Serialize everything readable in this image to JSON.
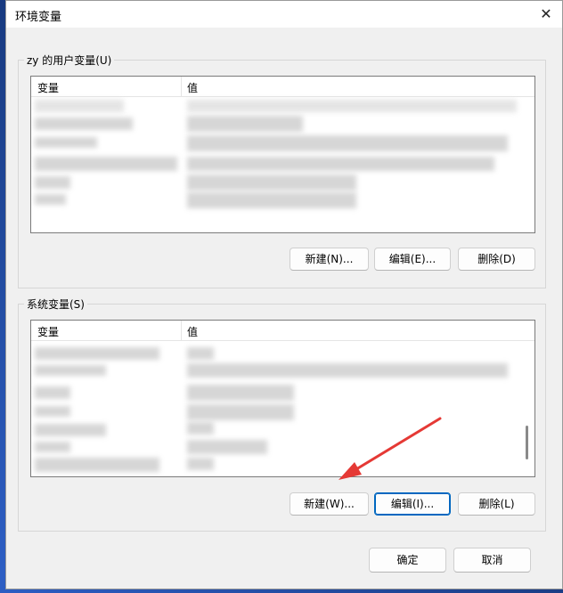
{
  "window": {
    "title": "环境变量",
    "close_glyph": "✕"
  },
  "user_group": {
    "label": "zy 的用户变量(U)",
    "columns": {
      "variable": "变量",
      "value": "值"
    },
    "buttons": {
      "new": "新建(N)...",
      "edit": "编辑(E)...",
      "delete": "删除(D)"
    }
  },
  "system_group": {
    "label": "系统变量(S)",
    "columns": {
      "variable": "变量",
      "value": "值"
    },
    "buttons": {
      "new": "新建(W)...",
      "edit": "编辑(I)...",
      "delete": "删除(L)"
    }
  },
  "footer": {
    "ok": "确定",
    "cancel": "取消"
  },
  "colors": {
    "accent": "#0067c0",
    "annotation_arrow": "#e53935"
  }
}
